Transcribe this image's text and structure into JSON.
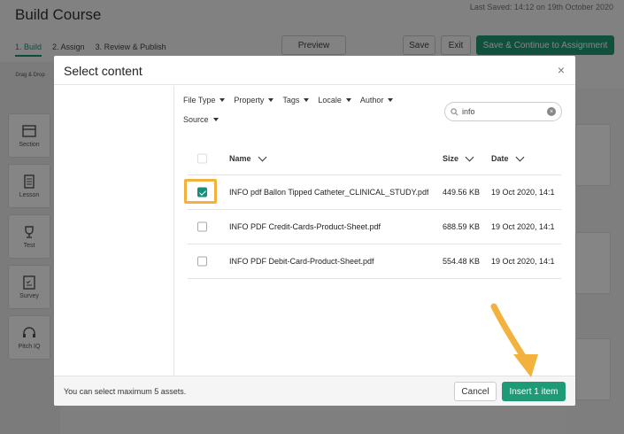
{
  "page": {
    "course_title": "Build Course",
    "last_saved": "Last Saved: 14:12 on 19th October 2020",
    "steps": [
      "1. Build",
      "2. Assign",
      "3. Review & Publish"
    ],
    "buttons": {
      "preview": "Preview",
      "save": "Save",
      "exit": "Exit",
      "save_continue": "Save & Continue to Assignment"
    },
    "drag_drop": "Drag & Drop",
    "tools": [
      "Section",
      "Lesson",
      "Test",
      "Survey",
      "Pitch IQ"
    ]
  },
  "modal": {
    "title": "Select content",
    "close": "×",
    "filters": [
      "File Type",
      "Property",
      "Tags",
      "Locale",
      "Author",
      "Source"
    ],
    "search": {
      "value": "info"
    },
    "columns": {
      "name": "Name",
      "size": "Size",
      "date": "Date"
    },
    "rows": [
      {
        "name": "INFO pdf Ballon Tipped Catheter_CLINICAL_STUDY.pdf",
        "size": "449.56 KB",
        "date": "19 Oct 2020, 14:1",
        "checked": true
      },
      {
        "name": "INFO PDF Credit-Cards-Product-Sheet.pdf",
        "size": "688.59 KB",
        "date": "19 Oct 2020, 14:1",
        "checked": false
      },
      {
        "name": "INFO PDF Debit-Card-Product-Sheet.pdf",
        "size": "554.48 KB",
        "date": "19 Oct 2020, 14:1",
        "checked": false
      }
    ],
    "footer": {
      "note": "You can select maximum 5 assets.",
      "cancel": "Cancel",
      "insert": "Insert 1 item"
    }
  },
  "colors": {
    "accent": "#1f9a76",
    "highlight": "#f3b13e"
  }
}
